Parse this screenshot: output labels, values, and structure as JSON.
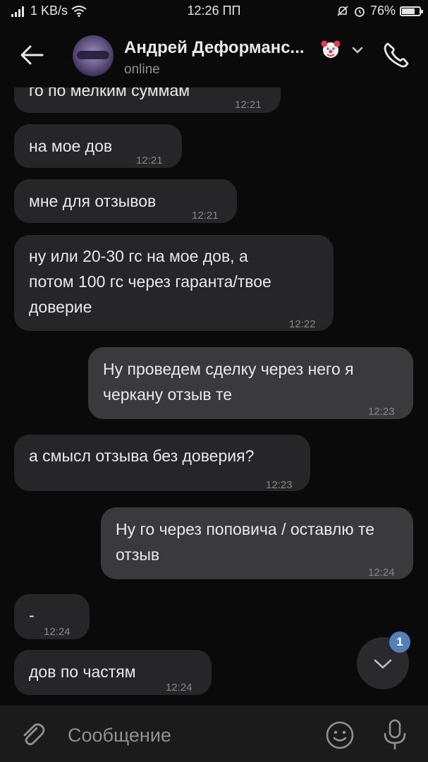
{
  "status_bar": {
    "network_speed": "1 KB/s",
    "time": "12:26 ПП",
    "battery": "76%",
    "battery_level": 0.76
  },
  "header": {
    "contact_name": "Андрей Деформанс...",
    "status": "online",
    "emoji_icon": "clown-face-icon"
  },
  "messages": [
    {
      "direction": "in",
      "text": "го по мелким суммам",
      "time": "12:21"
    },
    {
      "direction": "in",
      "text": "на мое дов",
      "time": "12:21"
    },
    {
      "direction": "in",
      "text": "мне для отзывов",
      "time": "12:21"
    },
    {
      "direction": "in",
      "text": "ну или 20-30 гс на мое дов, а потом 100 гс через гаранта/твое доверие",
      "time": "12:22"
    },
    {
      "direction": "out",
      "text": "Ну проведем сделку через него я черкану отзыв те",
      "time": "12:23"
    },
    {
      "direction": "in",
      "text": "а смысл отзыва без доверия?",
      "time": "12:23"
    },
    {
      "direction": "out",
      "text": "Ну го через поповича / оставлю те отзыв",
      "time": "12:24"
    },
    {
      "direction": "in",
      "text": "-",
      "time": "12:24"
    },
    {
      "direction": "in",
      "text": "дов по частям",
      "time": "12:24"
    }
  ],
  "scroll_button": {
    "badge": "1"
  },
  "composer": {
    "placeholder": "Сообщение"
  },
  "colors": {
    "background": "#0a0a0a",
    "incoming_bubble": "#262628",
    "outgoing_bubble": "#3a3a3c",
    "accent": "#5181b8"
  }
}
